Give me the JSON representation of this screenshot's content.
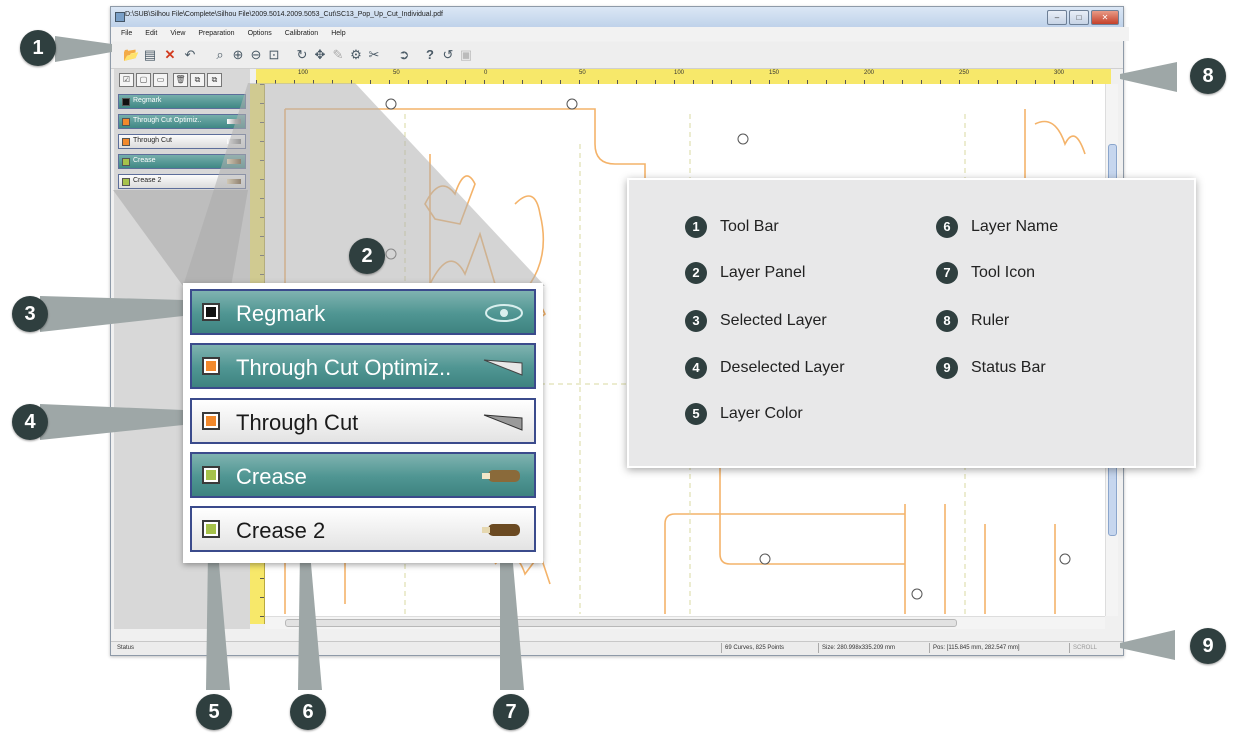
{
  "window": {
    "title": "D:\\SUB\\Silhou File\\Complete\\Silhou File\\2009.5014.2009.5053_Cut\\SC13_Pop_Up_Cut_Individual.pdf"
  },
  "menu": [
    "File",
    "Edit",
    "View",
    "Preparation",
    "Options",
    "Calibration",
    "Help"
  ],
  "ruler": {
    "labels": [
      "100",
      "50",
      "0",
      "50",
      "100",
      "150",
      "200",
      "250",
      "300"
    ]
  },
  "layers": [
    {
      "name": "Regmark",
      "color": "#111111",
      "state": "selected",
      "icon": "eye-icon"
    },
    {
      "name": "Through Cut Optimiz..",
      "color": "#f2892c",
      "state": "selected",
      "icon": "blade-icon"
    },
    {
      "name": "Through Cut",
      "color": "#f2892c",
      "state": "deselected",
      "icon": "blade-icon"
    },
    {
      "name": "Crease",
      "color": "#a6c24a",
      "state": "selected",
      "icon": "crease-tool-icon"
    },
    {
      "name": "Crease 2",
      "color": "#a6c24a",
      "state": "deselected",
      "icon": "crease-tool-icon"
    }
  ],
  "status": {
    "label": "Status",
    "curves": "69 Curves, 825 Points",
    "size": "Size: 280.998x335.209 mm",
    "pos": "Pos: [115.845 mm, 282.547 mm]",
    "scroll": "SCROLL"
  },
  "legend": [
    {
      "num": "1",
      "label": "Tool Bar"
    },
    {
      "num": "2",
      "label": "Layer Panel"
    },
    {
      "num": "3",
      "label": "Selected Layer"
    },
    {
      "num": "4",
      "label": "Deselected Layer"
    },
    {
      "num": "5",
      "label": "Layer Color"
    },
    {
      "num": "6",
      "label": "Layer Name"
    },
    {
      "num": "7",
      "label": "Tool Icon"
    },
    {
      "num": "8",
      "label": "Ruler"
    },
    {
      "num": "9",
      "label": "Status Bar"
    }
  ],
  "callouts": [
    "1",
    "2",
    "3",
    "4",
    "5",
    "6",
    "7",
    "8",
    "9"
  ],
  "colors": {
    "accent_teal": "#4f9592",
    "callout": "#2f3f3f",
    "ruler": "#f7e86a",
    "cut_line": "#f4b36a"
  }
}
